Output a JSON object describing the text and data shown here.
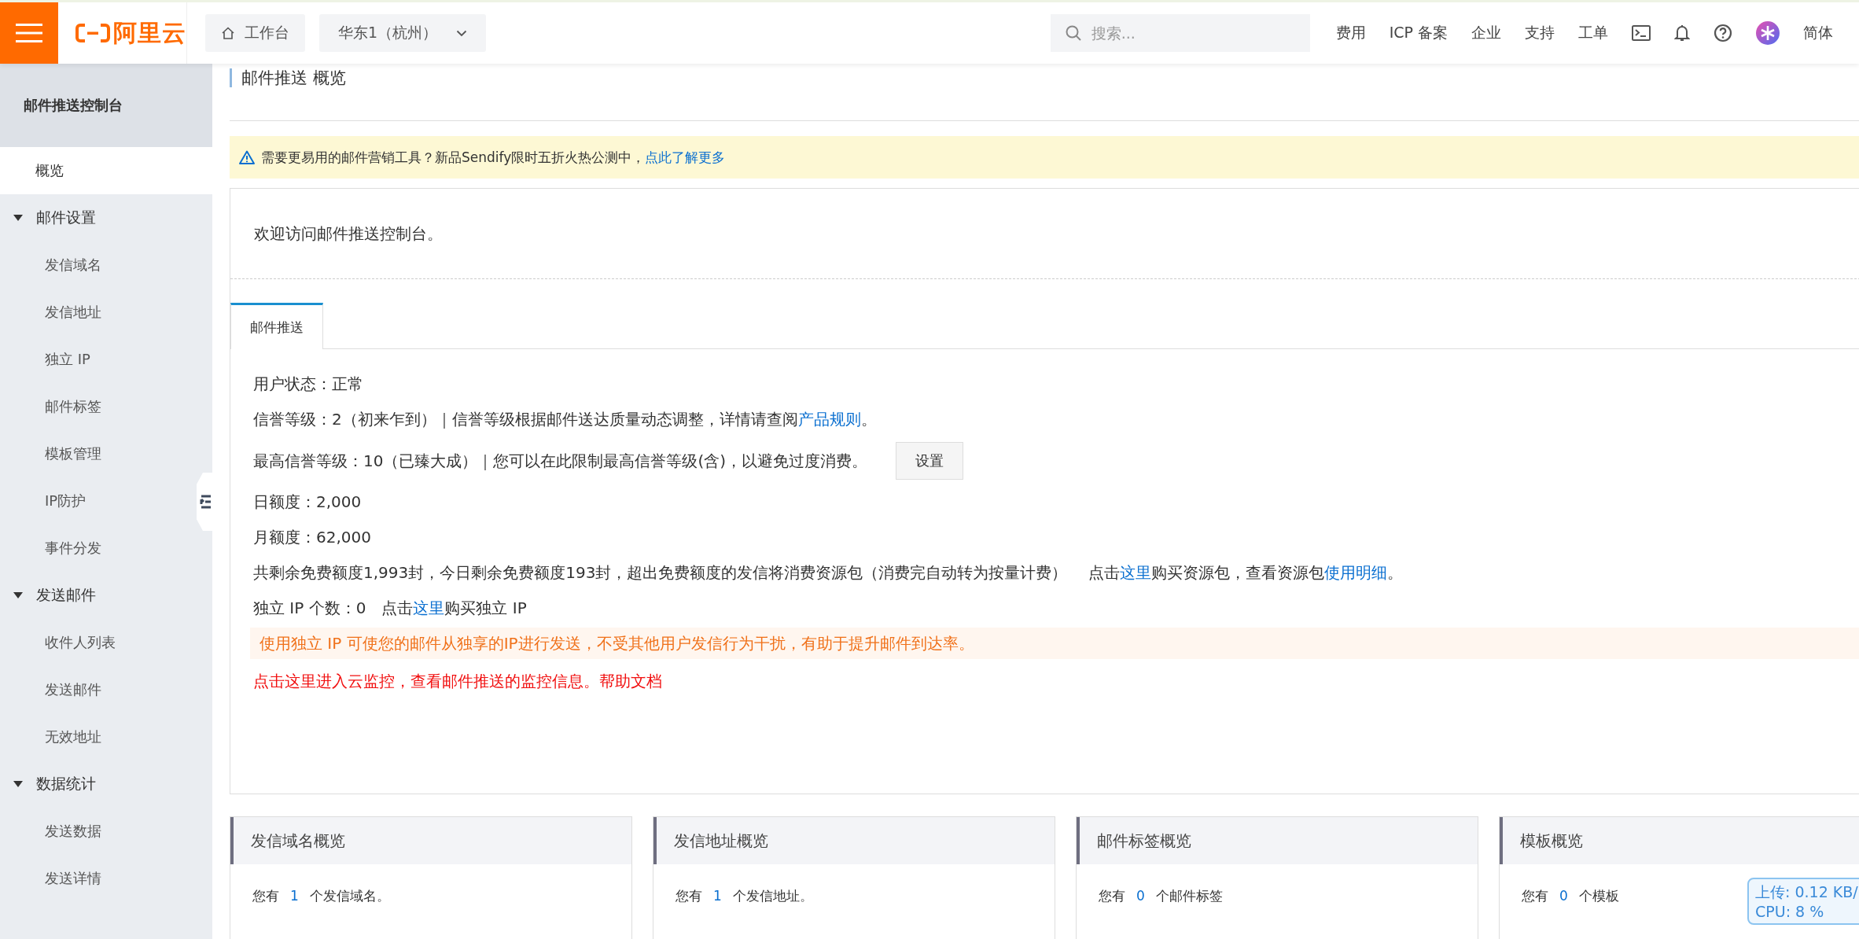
{
  "topbar": {
    "logo": "阿里云",
    "workbench": "工作台",
    "region": "华东1（杭州）",
    "search": {
      "placeholder": "搜索..."
    },
    "nav": [
      "费用",
      "ICP 备案",
      "企业",
      "支持",
      "工单"
    ],
    "language": "简体"
  },
  "sidebar": {
    "title": "邮件推送控制台",
    "items": [
      {
        "kind": "item",
        "label": "概览",
        "selected": true
      },
      {
        "kind": "group",
        "label": "邮件设置",
        "expanded": true,
        "children": [
          {
            "label": "发信域名",
            "selected": false
          },
          {
            "label": "发信地址",
            "selected": false
          },
          {
            "label": "独立 IP",
            "selected": false
          },
          {
            "label": "邮件标签",
            "selected": false
          },
          {
            "label": "模板管理",
            "selected": false
          },
          {
            "label": "IP防护",
            "selected": false
          },
          {
            "label": "事件分发",
            "selected": false
          }
        ]
      },
      {
        "kind": "group",
        "label": "发送邮件",
        "expanded": true,
        "children": [
          {
            "label": "收件人列表",
            "selected": false
          },
          {
            "label": "发送邮件",
            "selected": false
          },
          {
            "label": "无效地址",
            "selected": false
          }
        ]
      },
      {
        "kind": "group",
        "label": "数据统计",
        "expanded": true,
        "children": [
          {
            "label": "发送数据",
            "selected": false
          },
          {
            "label": "发送详情",
            "selected": false
          }
        ]
      }
    ]
  },
  "breadcrumb": "邮件推送 概览",
  "banner": {
    "text": "需要更易用的邮件营销工具？新品Sendify限时五折火热公测中，",
    "link": "点此了解更多"
  },
  "welcome": "欢迎访问邮件推送控制台。",
  "tabs": [
    {
      "label": "邮件推送",
      "selected": true
    }
  ],
  "info_lines": [
    {
      "kind": "plain",
      "segments": [
        {
          "kind": "text",
          "text": "用户状态：正常"
        }
      ]
    },
    {
      "kind": "plain",
      "segments": [
        {
          "kind": "text",
          "text": "信誉等级：2（初来乍到）｜信誉等级根据邮件送达质量动态调整，详情请查阅"
        },
        {
          "kind": "link",
          "text": "产品规则"
        },
        {
          "kind": "text",
          "text": "。"
        }
      ]
    },
    {
      "kind": "plain",
      "segments": [
        {
          "kind": "text",
          "text": "最高信誉等级：10（已臻大成）｜您可以在此限制最高信誉等级(含)，以避免过度消费。"
        }
      ],
      "button": "设置"
    },
    {
      "kind": "plain",
      "segments": [
        {
          "kind": "text",
          "text": "日额度：2,000"
        }
      ]
    },
    {
      "kind": "plain",
      "segments": [
        {
          "kind": "text",
          "text": "月额度：62,000"
        }
      ]
    },
    {
      "kind": "plain",
      "segments": [
        {
          "kind": "text",
          "text": "共剩余免费额度1,993封，今日剩余免费额度193封，超出免费额度的发信将消费资源包（消费完自动转为按量计费）　 点击"
        },
        {
          "kind": "link",
          "text": "这里"
        },
        {
          "kind": "text",
          "text": "购买资源包，查看资源包"
        },
        {
          "kind": "link",
          "text": "使用明细"
        },
        {
          "kind": "text",
          "text": "。"
        }
      ]
    },
    {
      "kind": "plain",
      "segments": [
        {
          "kind": "text",
          "text": "独立 IP 个数：0　点击"
        },
        {
          "kind": "link",
          "text": "这里"
        },
        {
          "kind": "text",
          "text": "购买独立 IP"
        }
      ]
    },
    {
      "kind": "notice",
      "segments": [
        {
          "kind": "text",
          "text": "使用独立 IP 可使您的邮件从独享的IP进行发送，不受其他用户发信行为干扰，有助于提升邮件到达率。"
        }
      ]
    },
    {
      "kind": "alert",
      "segments": [
        {
          "kind": "text",
          "text": "点击这里进入云监控，查看邮件推送的监控信息。帮助文档"
        }
      ]
    }
  ],
  "cards": [
    {
      "title": "发信域名概览",
      "prefix": "您有",
      "count": "1",
      "suffix": "个发信域名。"
    },
    {
      "title": "发信地址概览",
      "prefix": "您有",
      "count": "1",
      "suffix": "个发信地址。"
    },
    {
      "title": "邮件标签概览",
      "prefix": "您有",
      "count": "0",
      "suffix": "个邮件标签"
    },
    {
      "title": "模板概览",
      "prefix": "您有",
      "count": "0",
      "suffix": "个模板"
    }
  ],
  "monitor": {
    "upload": "上传: 0.12 KB/",
    "cpu": "CPU: 8 %"
  }
}
